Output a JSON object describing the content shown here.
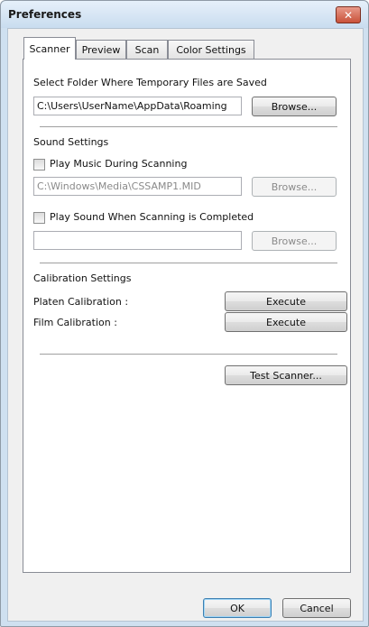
{
  "window": {
    "title": "Preferences",
    "close_label": "✕"
  },
  "tabs": [
    {
      "label": "Scanner",
      "active": true
    },
    {
      "label": "Preview",
      "active": false
    },
    {
      "label": "Scan",
      "active": false
    },
    {
      "label": "Color Settings",
      "active": false
    }
  ],
  "temp_folder": {
    "label": "Select Folder Where Temporary Files are Saved",
    "path": "C:\\Users\\UserName\\AppData\\Roaming",
    "browse_label": "Browse..."
  },
  "sound": {
    "heading": "Sound Settings",
    "music_label": "Play Music During Scanning",
    "music_checked": false,
    "music_path": "C:\\Windows\\Media\\CSSAMP1.MID",
    "music_browse_label": "Browse...",
    "complete_label": "Play Sound When Scanning is Completed",
    "complete_checked": false,
    "complete_path": "",
    "complete_browse_label": "Browse..."
  },
  "calibration": {
    "heading": "Calibration Settings",
    "platen_label": "Platen Calibration :",
    "platen_button": "Execute",
    "film_label": "Film Calibration :",
    "film_button": "Execute"
  },
  "test_scanner_label": "Test Scanner...",
  "footer": {
    "ok_label": "OK",
    "cancel_label": "Cancel"
  },
  "colors": {
    "title_bar": "#c9dcef",
    "close": "#c9523a",
    "panel": "#ffffff"
  }
}
